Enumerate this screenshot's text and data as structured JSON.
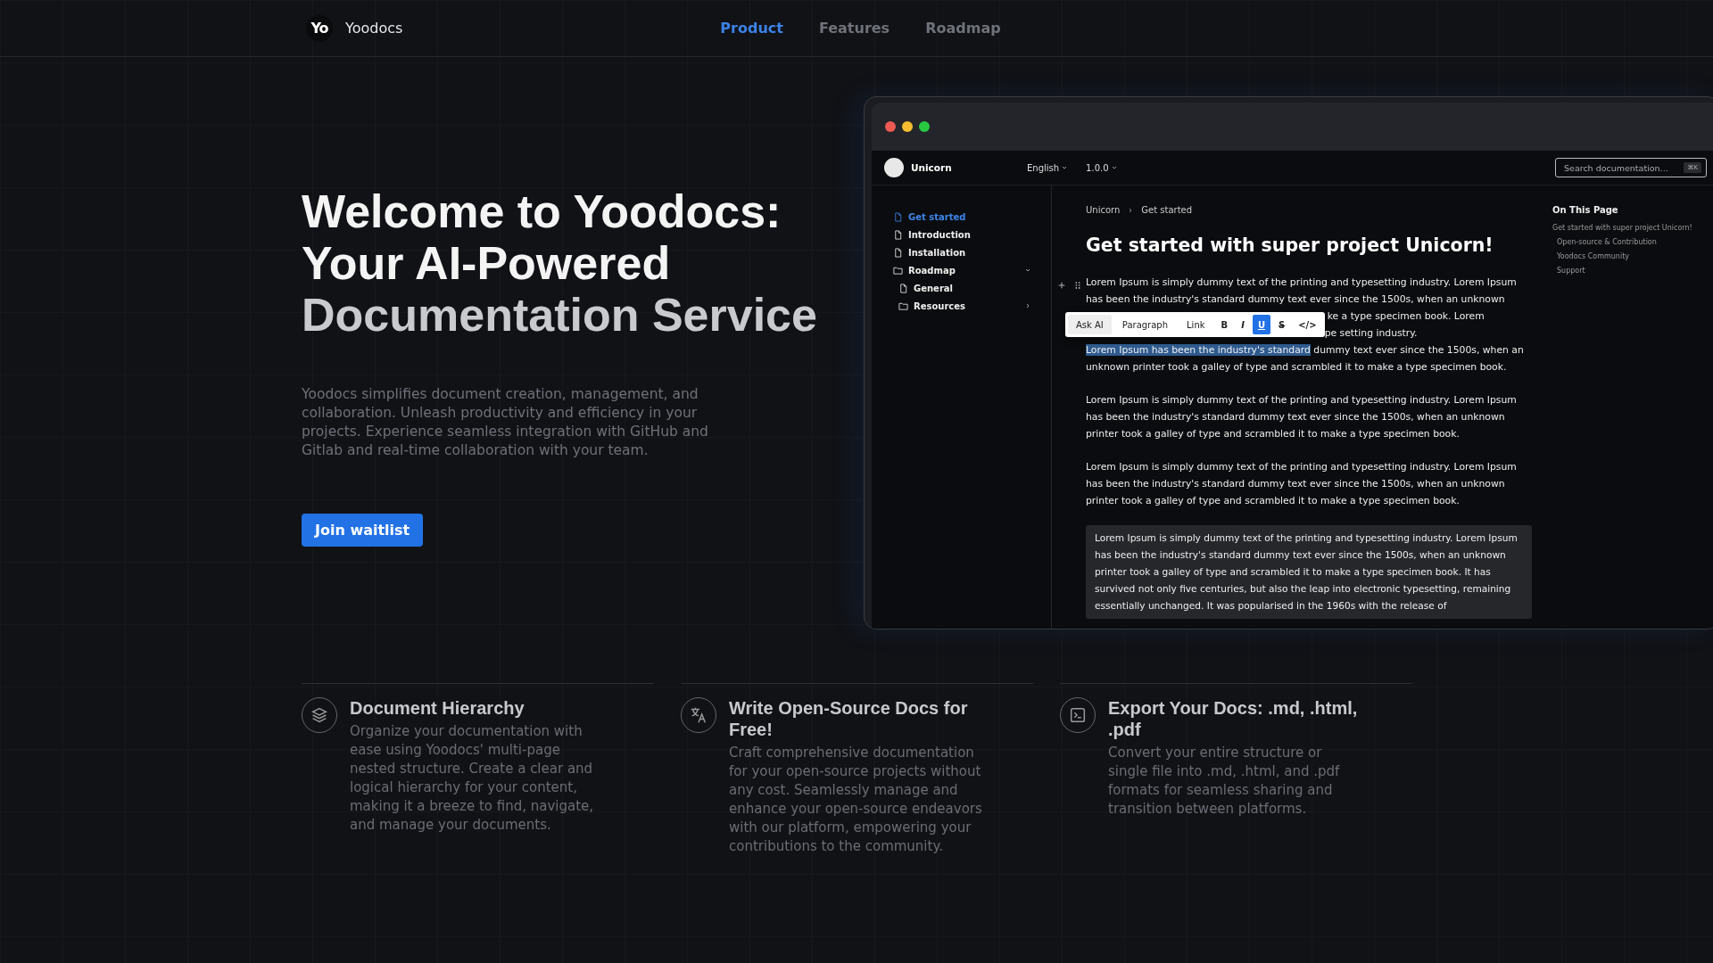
{
  "header": {
    "logo": "Yo",
    "brand": "Yoodocs",
    "nav": [
      {
        "label": "Product",
        "selected": true
      },
      {
        "label": "Features",
        "selected": false
      },
      {
        "label": "Roadmap",
        "selected": false
      }
    ]
  },
  "hero": {
    "title_lines": [
      "Welcome to Yoodocs:",
      "Your AI-Powered",
      "Documentation Service"
    ],
    "description": "Yoodocs simplifies document creation, management, and collaboration. Unleash productivity and efficiency in your projects. Experience seamless integration with GitHub and Gitlab and real-time collaboration with your team.",
    "button": "Join waitlist"
  },
  "app": {
    "project": "Unicorn",
    "language": "English",
    "version": "1.0.0",
    "search": {
      "placeholder": "Search documentation...",
      "shortcut": "⌘K"
    },
    "sidebar": [
      {
        "kind": "page",
        "label": "Get started",
        "selected": true
      },
      {
        "kind": "page",
        "label": "Introduction",
        "selected": false
      },
      {
        "kind": "page",
        "label": "Installation",
        "selected": false
      },
      {
        "kind": "folder",
        "label": "Roadmap",
        "selected": false,
        "expanded": true,
        "children": [
          {
            "kind": "page",
            "label": "General",
            "selected": false
          },
          {
            "kind": "folder",
            "label": "Resources",
            "selected": false,
            "expanded": false
          }
        ]
      }
    ],
    "breadcrumb": [
      "Unicorn",
      "Get started"
    ],
    "heading": "Get started with super project Unicorn!",
    "first_paragraph": {
      "lines": [
        "Lorem Ipsum is simply dummy text of the printing and typesetting industry. Lorem Ipsum",
        "has been the industry's standard dummy text ever since the 1500s, when an unknown"
      ],
      "after_toolbar": [
        "ke a type specimen book. Lorem",
        "pe setting industry."
      ]
    },
    "selected_paragraph": {
      "highlighted": "Lorem Ipsum has been the industry's standard",
      "rest": " dummy text ever since the 1500s, when an unknown printer took a galley of type and scrambled it to make a type specimen book."
    },
    "paragraphs": [
      "Lorem Ipsum is simply dummy text of the printing and typesetting industry. Lorem Ipsum has been the industry's standard dummy text ever since the 1500s, when an unknown printer took a galley of type and scrambled it to make a type specimen book.",
      "Lorem Ipsum is simply dummy text of the printing and typesetting industry. Lorem Ipsum has been the industry's standard dummy text ever since the 1500s, when an unknown printer took a galley of type and scrambled it to make a type specimen book."
    ],
    "quote": "Lorem Ipsum is simply dummy text of the printing and typesetting industry. Lorem Ipsum has been the industry's standard dummy text ever since the 1500s, when an unknown printer took a galley of type and scrambled it to make a type specimen book. It has survived not only five centuries, but also the leap into electronic typesetting, remaining essentially unchanged. It was popularised in the 1960s with the release of",
    "toolbar": [
      {
        "kind": "text",
        "label": "Ask AI",
        "selected": false
      },
      {
        "kind": "text",
        "label": "Paragraph",
        "selected": false
      },
      {
        "kind": "text",
        "label": "Link",
        "selected": false
      },
      {
        "kind": "format",
        "label": "B",
        "selected": false
      },
      {
        "kind": "format",
        "label": "I",
        "selected": false
      },
      {
        "kind": "format",
        "label": "U",
        "selected": true
      },
      {
        "kind": "format",
        "label": "S",
        "selected": false
      },
      {
        "kind": "format",
        "label": "</>",
        "selected": false
      }
    ],
    "toc_title": "On This Page",
    "toc": [
      {
        "label": "Get started with super project Unicorn!",
        "children": [
          {
            "label": "Open-source & Contribution"
          },
          {
            "label": "Yoodocs Community"
          },
          {
            "label": "Support"
          }
        ]
      }
    ]
  },
  "features": [
    {
      "kind": "layers",
      "title": "Document Hierarchy",
      "text": "Organize your documentation with ease using Yoodocs' multi-page nested structure. Create a clear and logical hierarchy for your content, making it a breeze to find, navigate, and manage your documents."
    },
    {
      "kind": "translate",
      "title": "Write Open-Source Docs for Free!",
      "text": "Craft comprehensive documentation for your open-source projects without any cost. Seamlessly manage and enhance your open-source endeavors with our platform, empowering your contributions to the community."
    },
    {
      "kind": "terminal",
      "title": "Export Your Docs: .md, .html, .pdf",
      "text": "Convert your entire structure or single file into .md, .html, and .pdf formats for seamless sharing and transition between platforms."
    }
  ]
}
